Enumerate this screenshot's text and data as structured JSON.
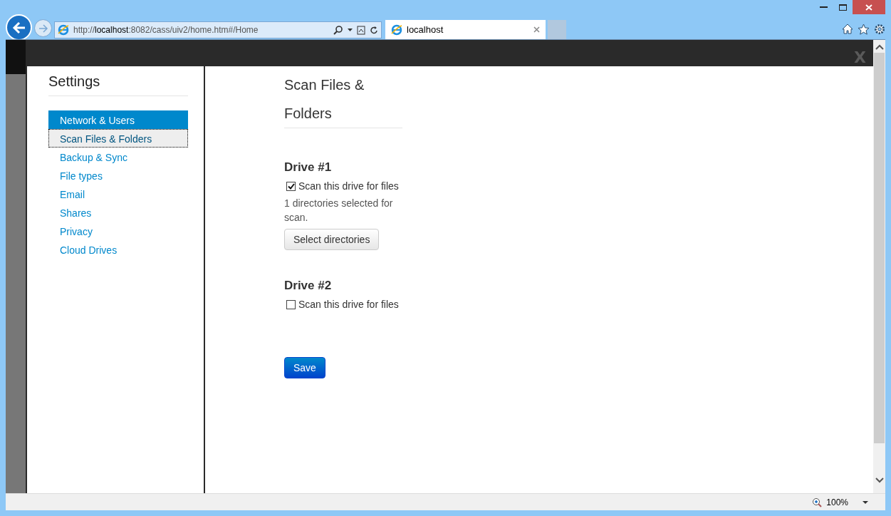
{
  "browser": {
    "url_prefix": "http://",
    "url_host": "localhost",
    "url_rest": ":8082/cass/uiv2/home.htm#/Home",
    "tab_title": "localhost",
    "zoom": "100%"
  },
  "dialog": {
    "close": "X"
  },
  "sidebar": {
    "title": "Settings",
    "items": [
      {
        "label": "Network & Users",
        "selected": true,
        "focused": false
      },
      {
        "label": "Scan Files & Folders",
        "selected": false,
        "focused": true
      },
      {
        "label": "Backup & Sync",
        "selected": false,
        "focused": false
      },
      {
        "label": "File types",
        "selected": false,
        "focused": false
      },
      {
        "label": "Email",
        "selected": false,
        "focused": false
      },
      {
        "label": "Shares",
        "selected": false,
        "focused": false
      },
      {
        "label": "Privacy",
        "selected": false,
        "focused": false
      },
      {
        "label": "Cloud Drives",
        "selected": false,
        "focused": false
      }
    ]
  },
  "main": {
    "title": "Scan Files & Folders",
    "drives": [
      {
        "name": "Drive #1",
        "checkbox_label": "Scan this drive for files",
        "checked": true,
        "info": "1 directories selected for scan.",
        "button": "Select directories"
      },
      {
        "name": "Drive #2",
        "checkbox_label": "Scan this drive for files",
        "checked": false
      }
    ],
    "save": "Save"
  }
}
